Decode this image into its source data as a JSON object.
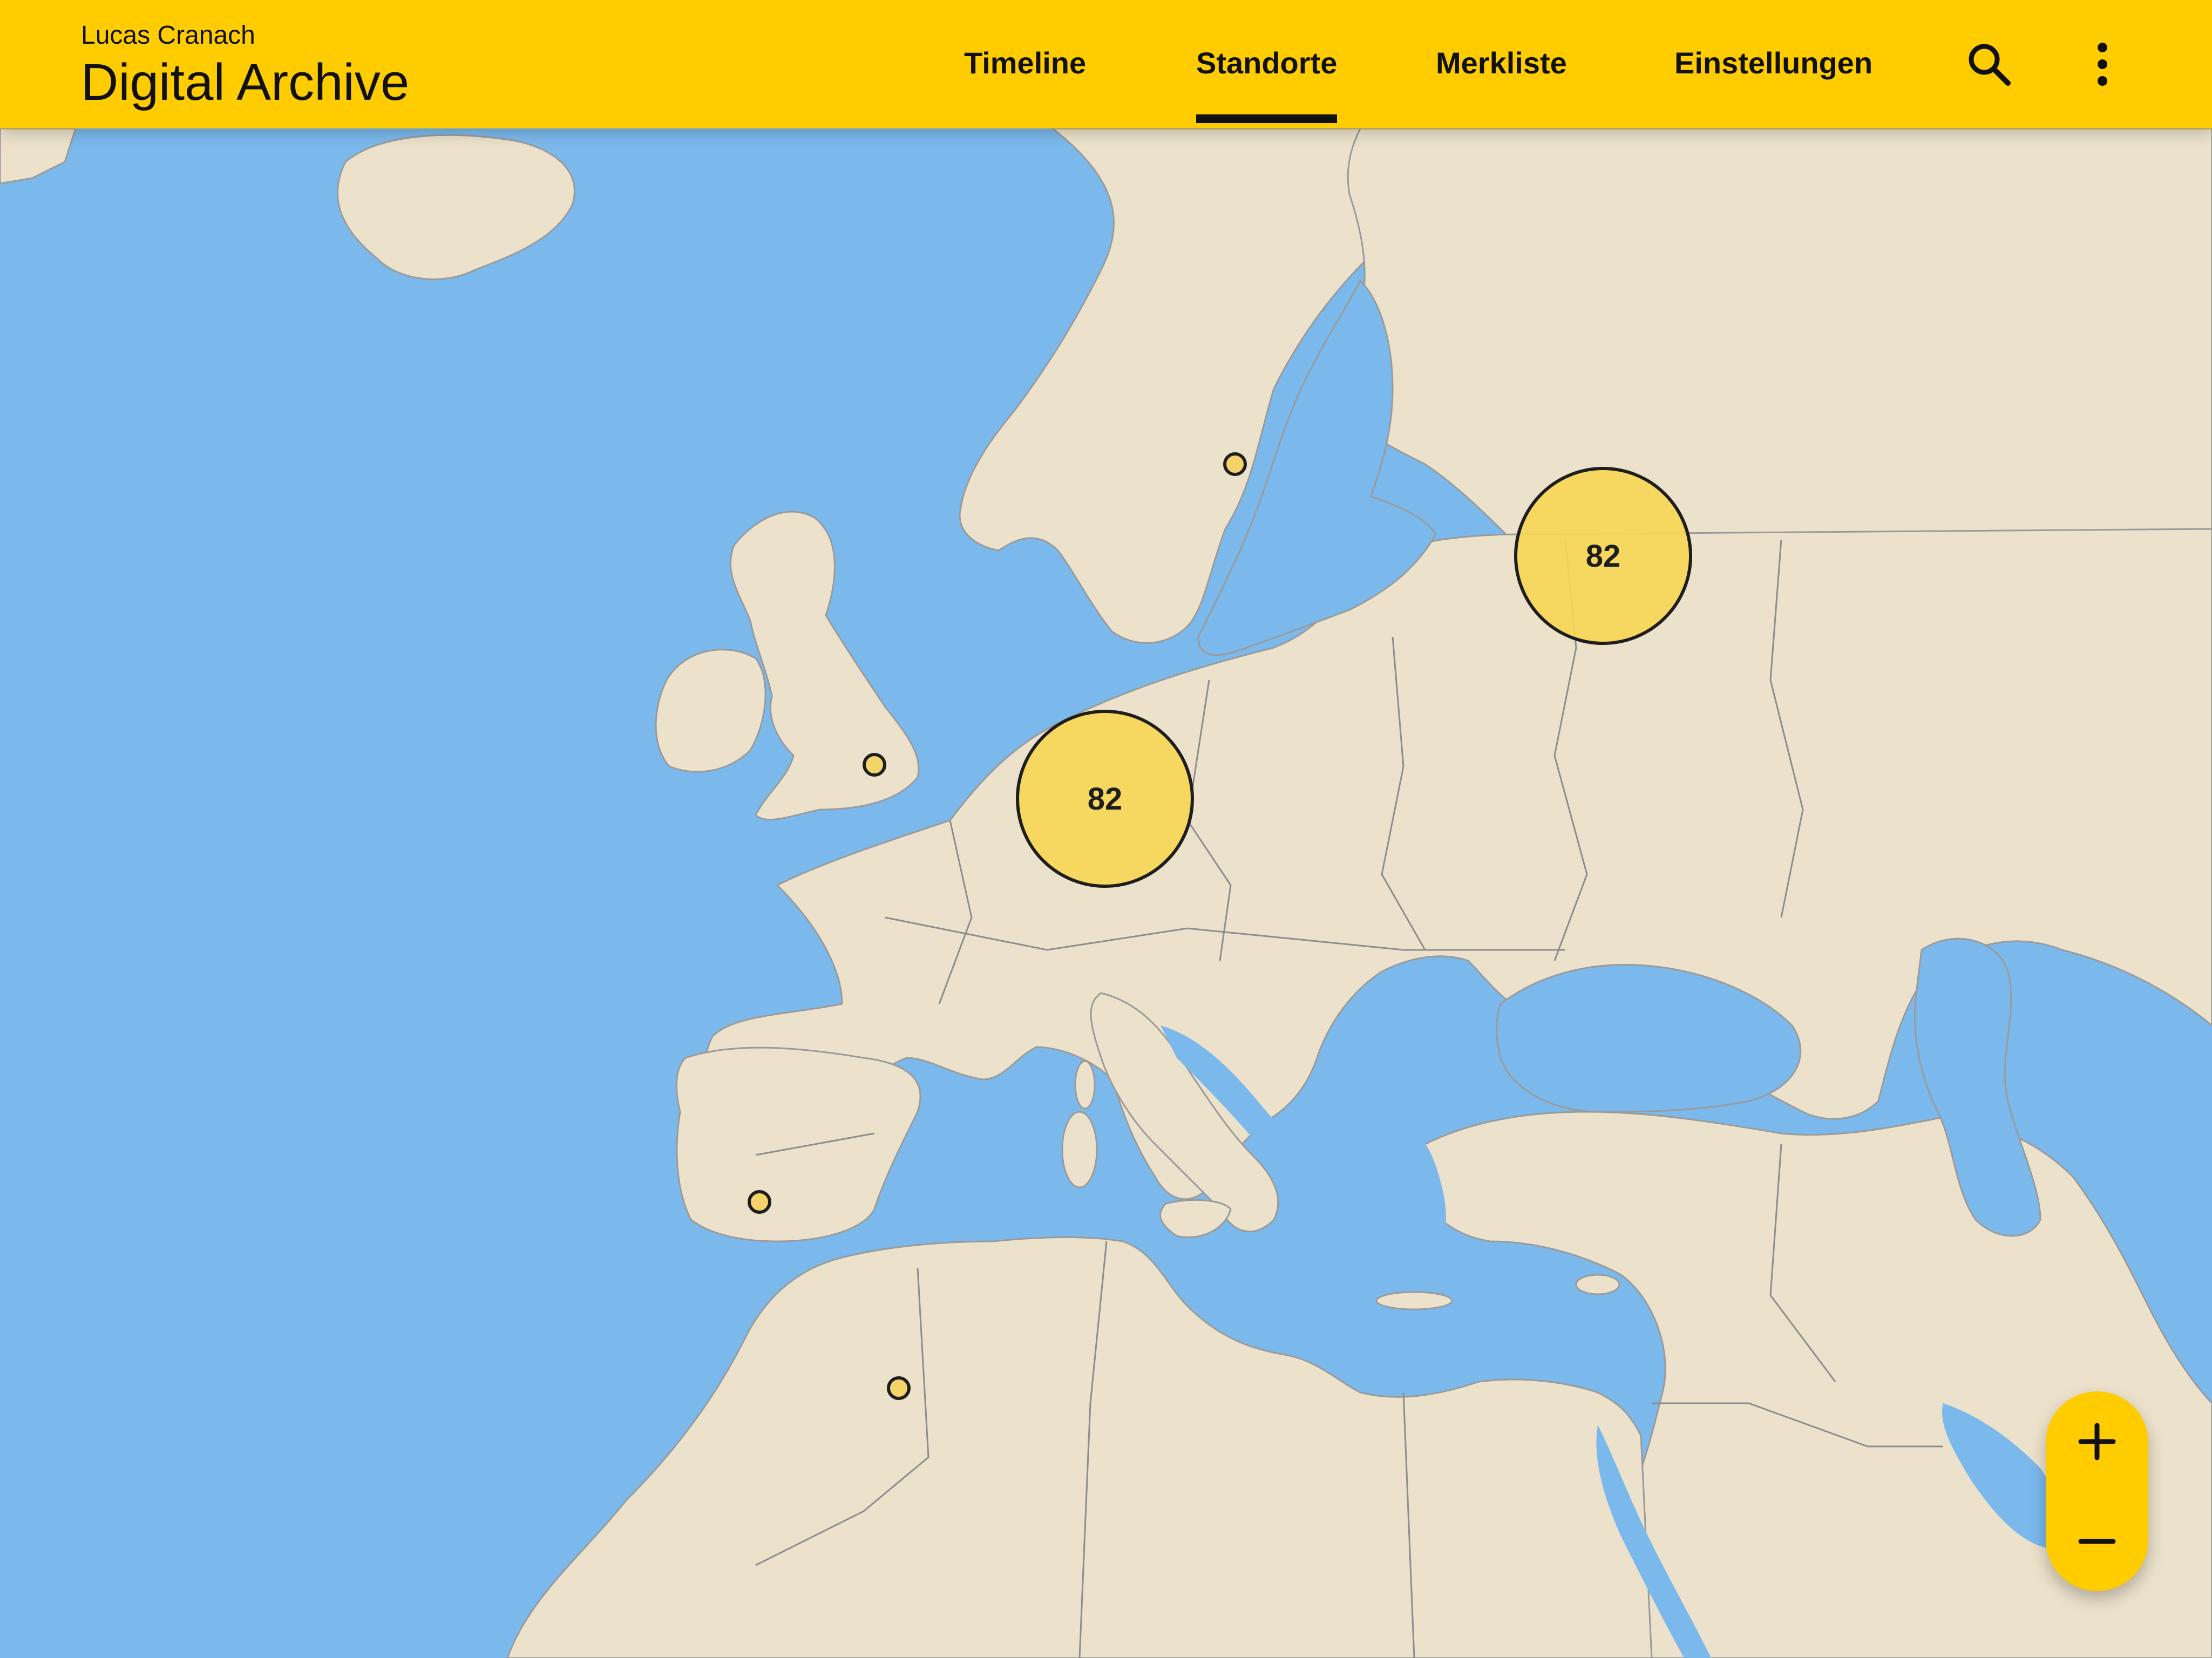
{
  "header": {
    "subtitle": "Lucas Cranach",
    "title": "Digital Archive"
  },
  "nav": {
    "tabs": [
      {
        "label": "Timeline",
        "active": false
      },
      {
        "label": "Standorte",
        "active": true
      },
      {
        "label": "Merkliste",
        "active": false
      },
      {
        "label": "Einstellungen",
        "active": false
      }
    ],
    "search_icon": "search-icon",
    "menu_icon": "more-vertical-icon"
  },
  "map": {
    "region": "Europe, North Africa and Middle East",
    "clusters": [
      {
        "count": "82",
        "area": "Germany"
      },
      {
        "count": "82",
        "area": "Belarus / Lithuania"
      }
    ],
    "points": [
      "Stockholm",
      "London",
      "Seville",
      "Algeria"
    ]
  },
  "zoom": {
    "in_icon": "plus-icon",
    "out_icon": "minus-icon"
  },
  "colors": {
    "accent": "#ffcc00",
    "water": "#7bb9ec",
    "land": "#ece2cb",
    "border": "#8d8d8d",
    "marker_fill": "#f4d46a",
    "marker_stroke": "#1e1e1e"
  }
}
